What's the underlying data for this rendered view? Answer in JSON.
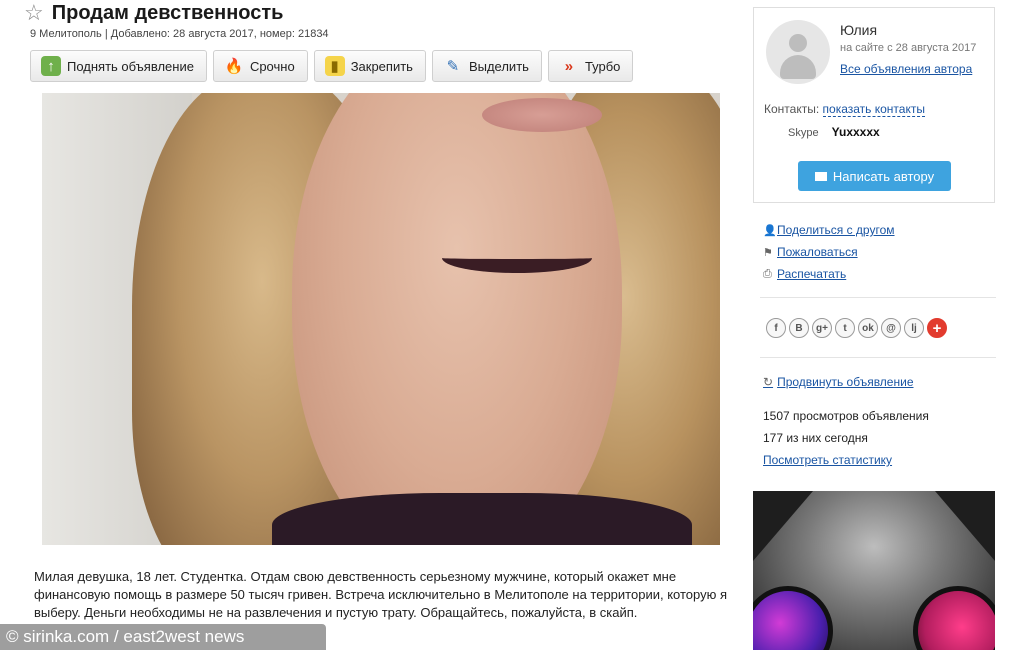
{
  "listing": {
    "title": "Продам девственность",
    "meta": "9 Мелитополь | Добавлено: 28 августа 2017, номер: 21834",
    "actions": [
      {
        "label": "Поднять объявление",
        "icon": "arrow-up-icon"
      },
      {
        "label": "Срочно",
        "icon": "fire-icon"
      },
      {
        "label": "Закрепить",
        "icon": "pin-icon"
      },
      {
        "label": "Выделить",
        "icon": "highlight-icon"
      },
      {
        "label": "Турбо",
        "icon": "turbo-icon"
      }
    ],
    "description": "Милая девушка, 18 лет. Студентка. Отдам свою девственность серьезному мужчине, который окажет мне финансовую помощь в размере 50 тысяч гривен. Встреча исключительно в Мелитополе на территории, которую я выберу. Деньги необходимы не на развлечения и пустую трату. Обращайтесь, пожалуйста, в скайп."
  },
  "author": {
    "name": "Юлия",
    "since": "на сайте с 28 августа 2017",
    "all_ads": "Все объявления автора",
    "contacts_label": "Контакты:",
    "show_contacts": "показать контакты",
    "skype_label": "Skype",
    "skype_value": "Yuxxxxx",
    "write_button": "Написать автору"
  },
  "links": [
    {
      "icon": "user-icon",
      "label": "Поделиться с другом"
    },
    {
      "icon": "flag-icon",
      "label": "Пожаловаться"
    },
    {
      "icon": "print-icon",
      "label": "Распечатать"
    }
  ],
  "social": [
    "f",
    "B",
    "g+",
    "t",
    "ok",
    "@",
    "lj",
    "+"
  ],
  "promo": "Продвинуть объявление",
  "stats": {
    "views_total": "1507 просмотров объявления",
    "views_today": "177 из них сегодня",
    "view_stats": "Посмотреть статистику"
  },
  "watermark": "© sirinka.com / east2west news",
  "colors": {
    "link": "#1a55a3",
    "button_blue": "#3ea3df",
    "social_plus": "#e23b2e"
  }
}
